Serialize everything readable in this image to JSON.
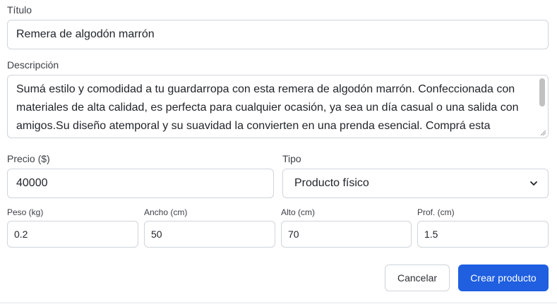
{
  "form": {
    "title": {
      "label": "Título",
      "value": "Remera de algodón marrón"
    },
    "description": {
      "label": "Descripción",
      "value": "Sumá estilo y comodidad a tu guardarropa con esta remera de algodón marrón. Confeccionada con materiales de alta calidad, es perfecta para cualquier ocasión, ya sea un día casual o una salida con amigos.Su diseño atemporal y su suavidad la convierten en una prenda esencial. Comprá esta remera y llevá tu look al siguiente nivel, disfrutando de la frescura y el confort propios del algodón."
    },
    "price": {
      "label": "Precio ($)",
      "value": "40000"
    },
    "type": {
      "label": "Tipo",
      "selected": "Producto físico"
    },
    "weight": {
      "label": "Peso (kg)",
      "value": "0.2"
    },
    "width": {
      "label": "Ancho (cm)",
      "value": "50"
    },
    "height": {
      "label": "Alto (cm)",
      "value": "70"
    },
    "depth": {
      "label": "Prof. (cm)",
      "value": "1.5"
    }
  },
  "actions": {
    "cancel_label": "Cancelar",
    "create_label": "Crear producto"
  },
  "colors": {
    "primary": "#1f5fe0",
    "border": "#cfd4da"
  }
}
